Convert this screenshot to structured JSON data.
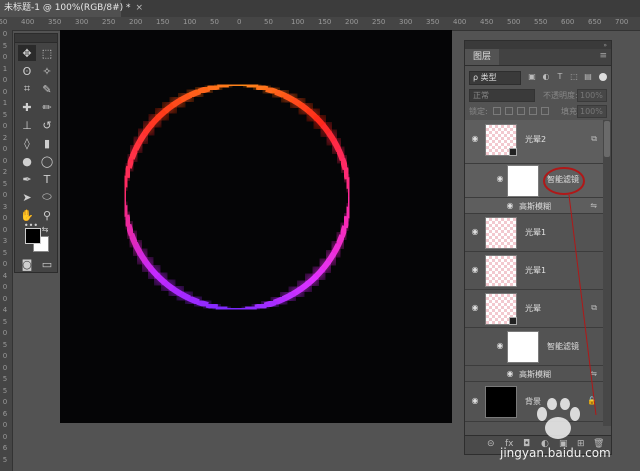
{
  "document_tab": {
    "title": "未标题-1 @ 100%(RGB/8#) *",
    "close": "×"
  },
  "ruler_top": [
    "450",
    "400",
    "350",
    "300",
    "250",
    "200",
    "150",
    "100",
    "50",
    "0",
    "50",
    "100",
    "150",
    "200",
    "250",
    "300",
    "350",
    "400",
    "450",
    "500",
    "550",
    "600",
    "650",
    "700"
  ],
  "ruler_left": [
    "0",
    "5",
    "0",
    "1",
    "0",
    "0",
    "1",
    "5",
    "0",
    "2",
    "0",
    "0",
    "2",
    "5",
    "0",
    "3",
    "0",
    "0",
    "3",
    "5",
    "0",
    "4",
    "0",
    "0",
    "4",
    "5",
    "0",
    "5",
    "0",
    "0",
    "5",
    "5",
    "0",
    "6",
    "0",
    "0",
    "6",
    "5"
  ],
  "tools": {
    "move": "✥",
    "marquee": "⬚",
    "lasso": "ʘ",
    "magic_wand": "✧",
    "crop": "⌗",
    "eyedropper": "✎",
    "heal": "✚",
    "brush": "✏",
    "stamp": "⊥",
    "history_brush": "↺",
    "eraser": "◊",
    "gradient": "▮",
    "blur": "●",
    "dodge": "◯",
    "pen": "✒",
    "type": "T",
    "path_select": "➤",
    "shape": "⬭",
    "hand": "✋",
    "zoom": "⚲",
    "more": "•••",
    "swap": "⇆",
    "default_colors": "▣",
    "quick_mask": "◙",
    "screen_mode": "▭"
  },
  "colors": {
    "foreground": "#000000",
    "background": "#ffffff",
    "canvas": "#050506"
  },
  "layers_panel": {
    "tab": "图层",
    "menu": "≡",
    "collapse": "»",
    "filter_kind": "ρ 类型",
    "blend_mode": "正常",
    "opacity_label": "不透明度:",
    "opacity_value": "100%",
    "lock_label": "锁定:",
    "fill_label": "填充:",
    "fill_value": "100%",
    "layers": [
      {
        "name": "光晕2",
        "eye": "◉",
        "sub_thumb_label": "智能滤镜",
        "sub_filter": "高斯模糊"
      },
      {
        "name": "光晕1",
        "eye": "◉"
      },
      {
        "name": "光晕1",
        "eye": "◉"
      },
      {
        "name": "光晕",
        "eye": "◉",
        "sub_thumb_label": "智能滤镜",
        "sub_filter": "高斯模糊"
      },
      {
        "name": "背景",
        "eye": "◉",
        "lock": "🔒"
      }
    ],
    "footer": [
      "⊝",
      "fx",
      "◘",
      "◐",
      "▣",
      "⊞",
      "🗑"
    ]
  },
  "ring_colors": [
    "#ff8a1a",
    "#ff2a1a",
    "#ff2aa0",
    "#e033ff",
    "#7a2aff",
    "#c42aff",
    "#ff2a6a",
    "#ff3a1a"
  ],
  "annotation_color": "#b01818",
  "watermark": "jingyan.baidu.com"
}
